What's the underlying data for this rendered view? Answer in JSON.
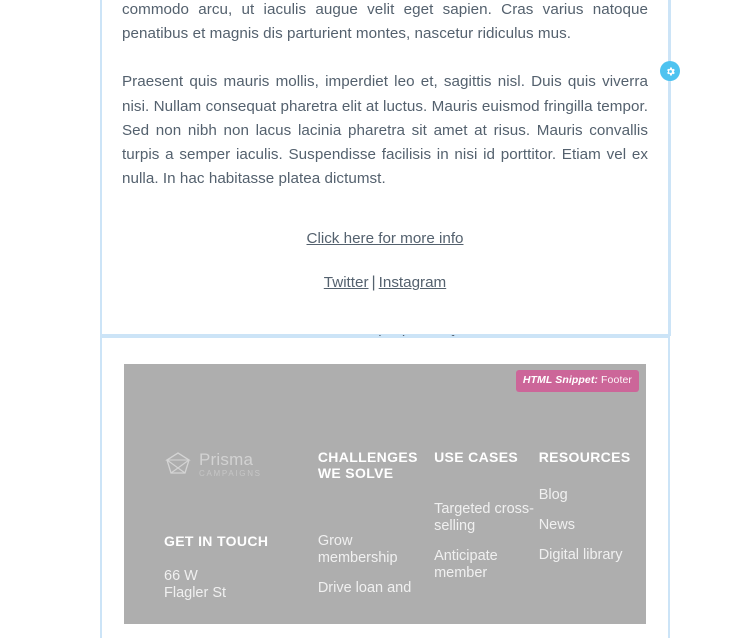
{
  "editor": {
    "accent_border_color": "#cce4f7",
    "gear_color": "#4ec3f0",
    "gear_icon": "gear-icon"
  },
  "content_block": {
    "paragraphs": [
      "commodo arcu, ut iaculis augue velit eget sapien. Cras varius natoque penatibus et magnis dis parturient montes, nascetur ridiculus mus.",
      "Praesent quis mauris mollis, imperdiet leo et, sagittis nisl. Duis quis viverra nisi. Nullam consequat pharetra elit at luctus. Mauris euismod fringilla tempor. Sed non nibh non lacus lacinia pharetra sit amet at risus. Mauris convallis turpis a semper iaculis. Suspendisse facilisis in nisi id porttitor. Etiam vel ex nulla. In hac habitasse platea dictumst."
    ],
    "cta_link": "Click here for more info",
    "social": {
      "first": "Twitter",
      "separator": "|",
      "second": "Instagram"
    },
    "preferences_link": "Manage Communication Preferences."
  },
  "footer_block": {
    "badge": {
      "prefix": "HTML Snippet:",
      "suffix": "Footer",
      "color": "#cc6699"
    },
    "background_color": "#aeaeae",
    "brand": {
      "name": "Prisma",
      "subtitle": "CAMPAIGNS",
      "logo_icon": "prisma-diamond-logo-icon"
    },
    "columns": [
      {
        "heading": "GET IN TOUCH",
        "items": [
          "66 W",
          "Flagler St"
        ]
      },
      {
        "heading": "CHALLENGES WE SOLVE",
        "items": [
          "Grow membership",
          "Drive loan and"
        ]
      },
      {
        "heading": "USE CASES",
        "items": [
          "Targeted cross-selling",
          "Anticipate member"
        ]
      },
      {
        "heading": "RESOURCES",
        "items": [
          "Blog",
          "News",
          "Digital library"
        ]
      }
    ]
  }
}
